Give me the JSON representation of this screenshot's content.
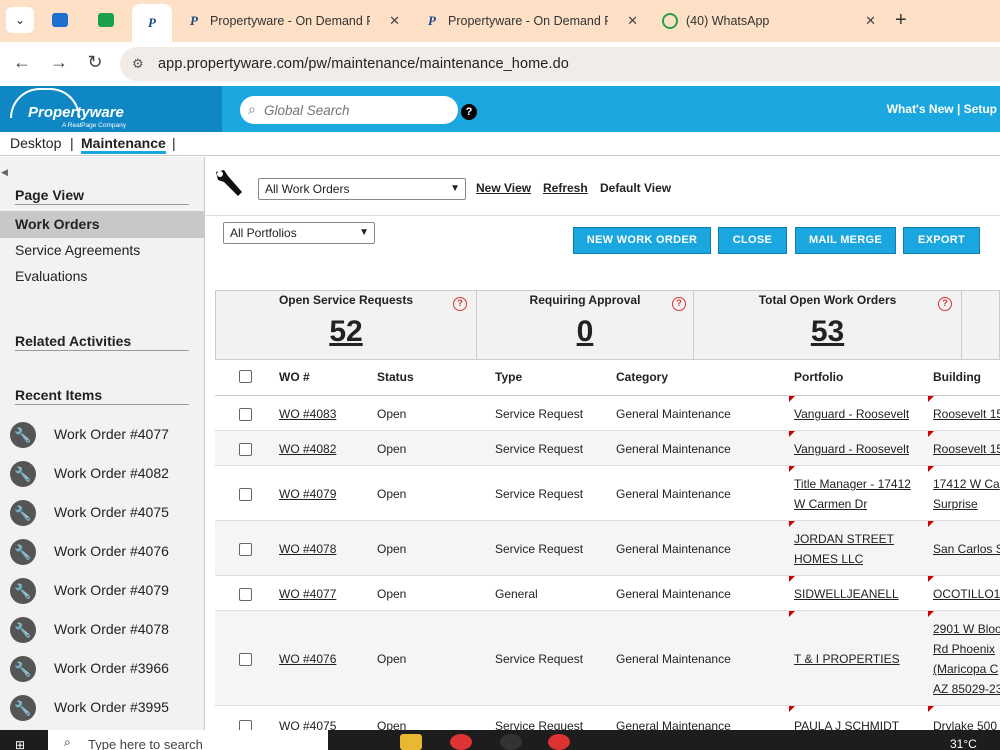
{
  "browser": {
    "tabs": [
      {
        "label": "Propertyware - On Demand Re"
      },
      {
        "label": "Propertyware - On Demand Re"
      },
      {
        "label": "(40) WhatsApp"
      }
    ],
    "close_glyph": "✕",
    "new_tab_glyph": "+",
    "url": "app.propertyware.com/pw/maintenance/maintenance_home.do"
  },
  "header": {
    "logo_text": "Propertyware",
    "logo_sub": "A RealPage Company",
    "search_placeholder": "Global Search",
    "help_glyph": "?",
    "whats_new": "What's New",
    "separator": "|",
    "setup": "Setup"
  },
  "modules": [
    {
      "label": "Desktop"
    },
    {
      "label": "Maintenance"
    }
  ],
  "module_separator": "|",
  "sidebar": {
    "page_view_heading": "Page View",
    "page_view_items": [
      {
        "label": "Work Orders"
      },
      {
        "label": "Service Agreements"
      },
      {
        "label": "Evaluations"
      }
    ],
    "related_heading": "Related Activities",
    "recent_heading": "Recent Items",
    "recent_items": [
      {
        "label": "Work Order #4077"
      },
      {
        "label": "Work Order #4082"
      },
      {
        "label": "Work Order #4075"
      },
      {
        "label": "Work Order #4076"
      },
      {
        "label": "Work Order #4079"
      },
      {
        "label": "Work Order #4078"
      },
      {
        "label": "Work Order #3966"
      },
      {
        "label": "Work Order #3995"
      }
    ]
  },
  "toolbar": {
    "view_select": "All Work Orders",
    "new_view": "New View",
    "refresh": "Refresh",
    "default_view": "Default View",
    "portfolio_select": "All Portfolios"
  },
  "actions": {
    "new_work_order": "NEW WORK ORDER",
    "close": "CLOSE",
    "mail_merge": "MAIL MERGE",
    "export": "EXPORT"
  },
  "stats": [
    {
      "title": "Open Service Requests",
      "value": "52"
    },
    {
      "title": "Requiring Approval",
      "value": "0"
    },
    {
      "title": "Total Open Work Orders",
      "value": "53"
    }
  ],
  "table": {
    "columns": {
      "wo": "WO #",
      "status": "Status",
      "type": "Type",
      "category": "Category",
      "portfolio": "Portfolio",
      "building": "Building"
    },
    "rows": [
      {
        "wo": "WO #4083",
        "status": "Open",
        "type": "Service Request",
        "category": "General Maintenance",
        "portfolio": [
          "Vanguard - Roosevelt"
        ],
        "building": [
          "Roosevelt 15"
        ]
      },
      {
        "wo": "WO #4082",
        "status": "Open",
        "type": "Service Request",
        "category": "General Maintenance",
        "portfolio": [
          "Vanguard - Roosevelt"
        ],
        "building": [
          "Roosevelt 15"
        ]
      },
      {
        "wo": "WO #4079",
        "status": "Open",
        "type": "Service Request",
        "category": "General Maintenance",
        "portfolio": [
          "Title Manager - 17412",
          "W Carmen Dr"
        ],
        "building": [
          "17412 W Ca",
          "Surprise"
        ]
      },
      {
        "wo": "WO #4078",
        "status": "Open",
        "type": "Service Request",
        "category": "General Maintenance",
        "portfolio": [
          "JORDAN STREET",
          "HOMES LLC"
        ],
        "building": [
          "San Carlos S"
        ]
      },
      {
        "wo": "WO #4077",
        "status": "Open",
        "type": "General",
        "category": "General Maintenance",
        "portfolio": [
          "SIDWELLJEANELL"
        ],
        "building": [
          "OCOTILLO1"
        ]
      },
      {
        "wo": "WO #4076",
        "status": "Open",
        "type": "Service Request",
        "category": "General Maintenance",
        "portfolio": [
          "T & I PROPERTIES"
        ],
        "building": [
          "2901 W Bloo",
          "Rd Phoenix",
          "(Maricopa C",
          "AZ 85029-23"
        ]
      },
      {
        "wo": "WO #4075",
        "status": "Open",
        "type": "Service Request",
        "category": "General Maintenance",
        "portfolio": [
          "PAULA J SCHMIDT"
        ],
        "building": [
          "Drylake 500"
        ]
      }
    ]
  },
  "taskbar": {
    "search_text": "Type here to search",
    "weather": "31°C"
  },
  "colors": {
    "accent": "#1aa7e0",
    "tab_bg": "#fde0c6",
    "flag": "#cc0000"
  }
}
